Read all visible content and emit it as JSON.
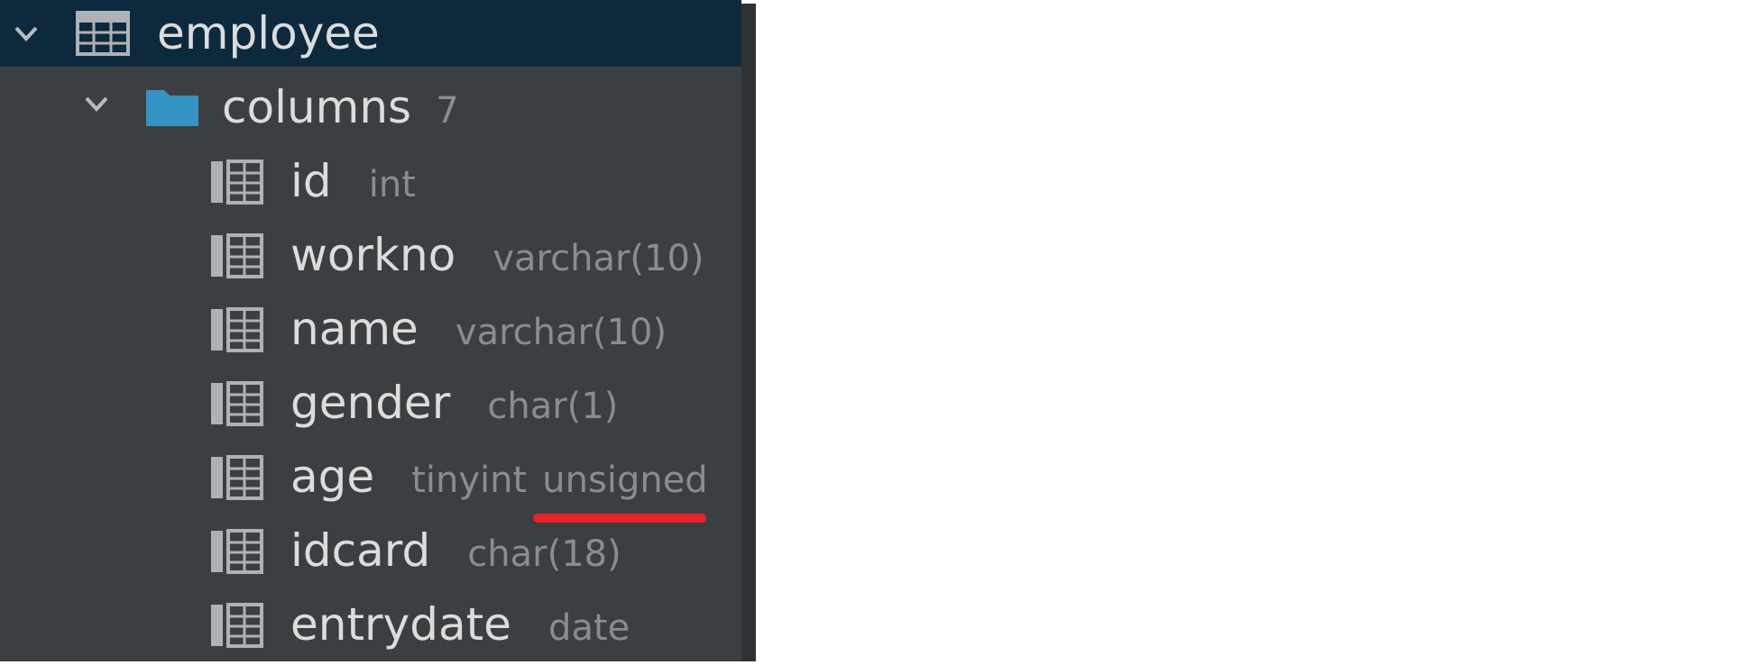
{
  "tree": {
    "table": {
      "name": "employee",
      "icon": "table-icon"
    },
    "columns_folder": {
      "label": "columns",
      "count": "7",
      "icon": "folder-icon",
      "color": "#3592c4"
    },
    "columns": [
      {
        "name": "id",
        "type": "int"
      },
      {
        "name": "workno",
        "type": "varchar(10)"
      },
      {
        "name": "name",
        "type": "varchar(10)"
      },
      {
        "name": "gender",
        "type": "char(1)"
      },
      {
        "name": "age",
        "type": "tinyint",
        "type_extra": "unsigned"
      },
      {
        "name": "idcard",
        "type": "char(18)"
      },
      {
        "name": "entrydate",
        "type": "date"
      }
    ]
  },
  "colors": {
    "panel_bg": "#3c3f41",
    "selected_bg": "#0d293e",
    "annotation_underline": "#e8212a"
  }
}
